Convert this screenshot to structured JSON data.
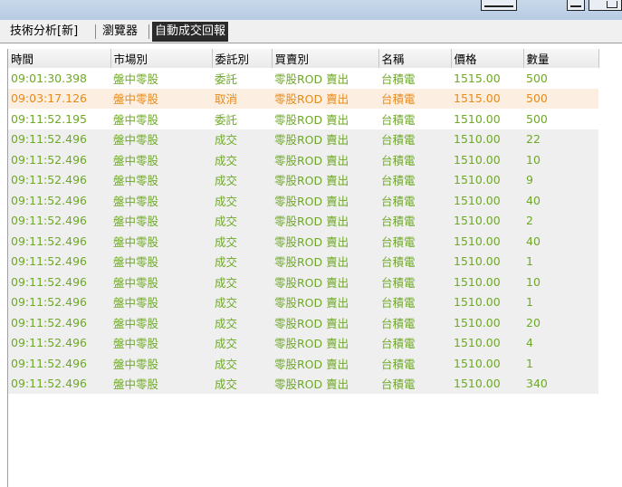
{
  "tabs": [
    {
      "label": "技術分析[新]",
      "active": false
    },
    {
      "label": "瀏覽器",
      "active": false
    },
    {
      "label": "自動成交回報",
      "active": true
    }
  ],
  "table": {
    "columns": [
      "時間",
      "市場別",
      "委託別",
      "買賣別",
      "名稱",
      "價格",
      "數量"
    ],
    "rows": [
      {
        "time": "09:01:30.398",
        "market": "盤中零股",
        "type": "委託",
        "side": "零股ROD 賣出",
        "name": "台積電",
        "price": "1515.00",
        "qty": "500",
        "style": "white"
      },
      {
        "time": "09:03:17.126",
        "market": "盤中零股",
        "type": "取消",
        "side": "零股ROD 賣出",
        "name": "台積電",
        "price": "1515.00",
        "qty": "500",
        "style": "peach"
      },
      {
        "time": "09:11:52.195",
        "market": "盤中零股",
        "type": "委託",
        "side": "零股ROD 賣出",
        "name": "台積電",
        "price": "1510.00",
        "qty": "500",
        "style": "white"
      },
      {
        "time": "09:11:52.496",
        "market": "盤中零股",
        "type": "成交",
        "side": "零股ROD 賣出",
        "name": "台積電",
        "price": "1510.00",
        "qty": "22",
        "style": "gray"
      },
      {
        "time": "09:11:52.496",
        "market": "盤中零股",
        "type": "成交",
        "side": "零股ROD 賣出",
        "name": "台積電",
        "price": "1510.00",
        "qty": "10",
        "style": "gray"
      },
      {
        "time": "09:11:52.496",
        "market": "盤中零股",
        "type": "成交",
        "side": "零股ROD 賣出",
        "name": "台積電",
        "price": "1510.00",
        "qty": "9",
        "style": "gray"
      },
      {
        "time": "09:11:52.496",
        "market": "盤中零股",
        "type": "成交",
        "side": "零股ROD 賣出",
        "name": "台積電",
        "price": "1510.00",
        "qty": "40",
        "style": "gray"
      },
      {
        "time": "09:11:52.496",
        "market": "盤中零股",
        "type": "成交",
        "side": "零股ROD 賣出",
        "name": "台積電",
        "price": "1510.00",
        "qty": "2",
        "style": "gray"
      },
      {
        "time": "09:11:52.496",
        "market": "盤中零股",
        "type": "成交",
        "side": "零股ROD 賣出",
        "name": "台積電",
        "price": "1510.00",
        "qty": "40",
        "style": "gray"
      },
      {
        "time": "09:11:52.496",
        "market": "盤中零股",
        "type": "成交",
        "side": "零股ROD 賣出",
        "name": "台積電",
        "price": "1510.00",
        "qty": "1",
        "style": "gray"
      },
      {
        "time": "09:11:52.496",
        "market": "盤中零股",
        "type": "成交",
        "side": "零股ROD 賣出",
        "name": "台積電",
        "price": "1510.00",
        "qty": "10",
        "style": "gray"
      },
      {
        "time": "09:11:52.496",
        "market": "盤中零股",
        "type": "成交",
        "side": "零股ROD 賣出",
        "name": "台積電",
        "price": "1510.00",
        "qty": "1",
        "style": "gray"
      },
      {
        "time": "09:11:52.496",
        "market": "盤中零股",
        "type": "成交",
        "side": "零股ROD 賣出",
        "name": "台積電",
        "price": "1510.00",
        "qty": "20",
        "style": "gray"
      },
      {
        "time": "09:11:52.496",
        "market": "盤中零股",
        "type": "成交",
        "side": "零股ROD 賣出",
        "name": "台積電",
        "price": "1510.00",
        "qty": "4",
        "style": "gray"
      },
      {
        "time": "09:11:52.496",
        "market": "盤中零股",
        "type": "成交",
        "side": "零股ROD 賣出",
        "name": "台積電",
        "price": "1510.00",
        "qty": "1",
        "style": "gray"
      },
      {
        "time": "09:11:52.496",
        "market": "盤中零股",
        "type": "成交",
        "side": "零股ROD 賣出",
        "name": "台積電",
        "price": "1510.00",
        "qty": "340",
        "style": "gray"
      }
    ]
  },
  "colors": {
    "text_green": "#6fa829",
    "text_orange": "#e88a1a",
    "row_peach": "#fcefe2",
    "row_gray": "#efefef",
    "active_tab": "#2b2b2b"
  },
  "icons": {
    "titlebar_buttons": [
      "minimize-icon",
      "restore-icon"
    ]
  }
}
